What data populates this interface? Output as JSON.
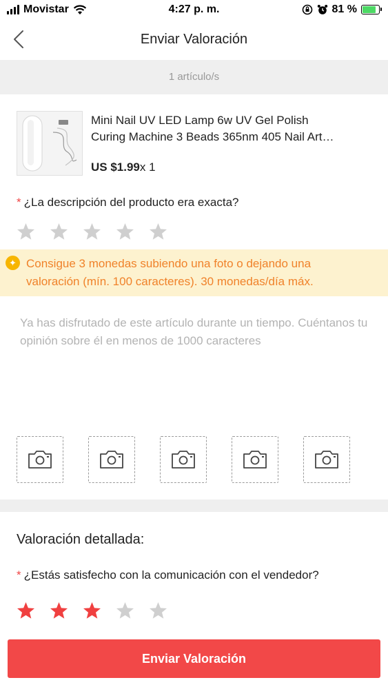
{
  "status_bar": {
    "carrier": "Movistar",
    "time": "4:27 p. m.",
    "battery_percent": "81 %",
    "battery_level": 0.81
  },
  "nav": {
    "title": "Enviar Valoración",
    "back_icon": "chevron-left-icon"
  },
  "item_count": "1 artículo/s",
  "product": {
    "title_line1": "Mini Nail UV LED Lamp 6w UV Gel Polish",
    "title_line2": "Curing Machine 3 Beads 365nm 405 Nail Art…",
    "price": "US $1.99",
    "quantity": "x 1"
  },
  "accuracy_question": {
    "required_mark": "*",
    "label": "¿La descripción del producto era exacta?",
    "rating": 0,
    "max": 5
  },
  "coins_notice": {
    "icon": "coin-icon",
    "line1": "Consigue 3 monedas subiendo una foto o dejando una",
    "line2": "valoración (mín. 100 caracteres). 30 monedas/día máx."
  },
  "review_input": {
    "placeholder": "Ya has disfrutado de este artículo durante un tiempo. Cuéntanos tu opinión sobre él en menos de 1000 caracteres"
  },
  "photo_slots": 5,
  "detailed": {
    "title": "Valoración detallada:",
    "question": {
      "required_mark": "*",
      "label": "¿Estás satisfecho con la comunicación con el vendedor?",
      "rating": 3,
      "max": 5
    }
  },
  "submit_label": "Enviar Valoración",
  "colors": {
    "accent": "#f24848",
    "star_active": "#f04040",
    "star_inactive": "#cfcfcf",
    "notice_bg": "#fdf2cf",
    "notice_text": "#f0822a"
  }
}
